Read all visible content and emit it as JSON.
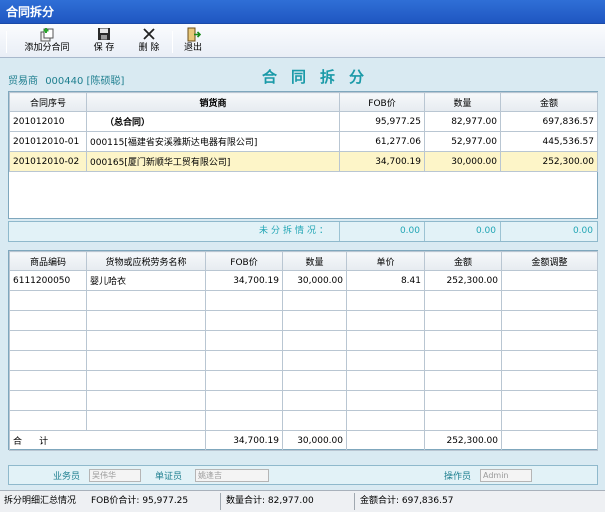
{
  "window": {
    "title": "合同拆分"
  },
  "toolbar": {
    "add_label": "添加分合同",
    "save_label": "保 存",
    "delete_label": "删 除",
    "exit_label": "退出"
  },
  "trader": {
    "label": "贸易商",
    "value": "000440 [陈硕聪]"
  },
  "page_title": "合同拆分",
  "contracts": {
    "headers": [
      "合同序号",
      "销货商",
      "FOB价",
      "数量",
      "金额"
    ],
    "rows": [
      [
        "201012010",
        "（总合同）",
        "95,977.25",
        "82,977.00",
        "697,836.57"
      ],
      [
        "201012010-01",
        "000115[福建省安溪雅斯达电器有限公司]",
        "61,277.06",
        "52,977.00",
        "445,536.57"
      ],
      [
        "201012010-02",
        "000165[厦门新顺华工贸有限公司]",
        "34,700.19",
        "30,000.00",
        "252,300.00"
      ]
    ]
  },
  "unsplit": {
    "label": "未分拆情况：",
    "fob": "0.00",
    "qty": "0.00",
    "amount": "0.00"
  },
  "goods": {
    "headers": [
      "商品编码",
      "货物或应税劳务名称",
      "FOB价",
      "数量",
      "单价",
      "金额",
      "金额调整"
    ],
    "rows": [
      [
        "6111200050",
        "婴儿哈衣",
        "34,700.19",
        "30,000.00",
        "8.41",
        "252,300.00",
        ""
      ]
    ],
    "total": {
      "label": "合      计",
      "fob": "34,700.19",
      "qty": "30,000.00",
      "amount": "252,300.00"
    }
  },
  "staff": {
    "sales_label": "业务员",
    "sales_value": "吴伟华",
    "doc_label": "单证员",
    "doc_value": "姚逢吉",
    "operator_label": "操作员",
    "operator_value": "Admin"
  },
  "status": {
    "summary_label": "拆分明细汇总情况",
    "fob_total": "FOB价合计: 95,977.25",
    "qty_total": "数量合计: 82,977.00",
    "amount_total": "金额合计: 697,836.57"
  },
  "colors": {
    "title_bar": "#1f56c1",
    "accent": "#1a9aa8",
    "highlight_row": "#fdf5c8"
  }
}
